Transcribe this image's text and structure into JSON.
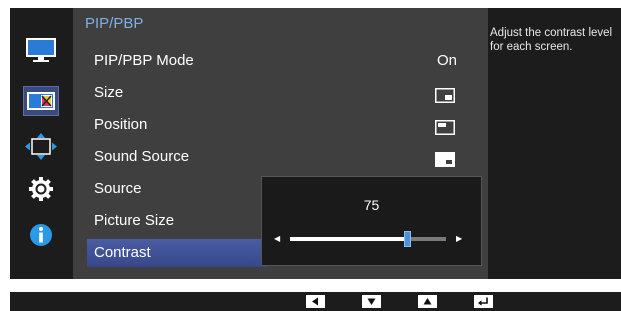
{
  "menu": {
    "title": "PIP/PBP",
    "items": [
      {
        "label": "PIP/PBP Mode",
        "value": "On"
      },
      {
        "label": "Size",
        "icon": "pip-size-icon"
      },
      {
        "label": "Position",
        "icon": "pip-position-icon"
      },
      {
        "label": "Sound Source",
        "icon": "sound-source-icon"
      },
      {
        "label": "Source"
      },
      {
        "label": "Picture Size"
      },
      {
        "label": "Contrast"
      }
    ]
  },
  "description": "Adjust the contrast level for each screen.",
  "slider": {
    "value": "75",
    "level_fraction": 0.75
  },
  "categories": [
    {
      "icon": "picture-icon"
    },
    {
      "icon": "color-icon",
      "selected": true
    },
    {
      "icon": "size-position-icon"
    },
    {
      "icon": "settings-icon"
    },
    {
      "icon": "info-icon"
    }
  ],
  "nav_buttons": [
    {
      "icon": "left-arrow-icon"
    },
    {
      "icon": "down-arrow-icon"
    },
    {
      "icon": "up-arrow-icon"
    },
    {
      "icon": "enter-icon"
    }
  ],
  "colors": {
    "selection": "#3f50a0",
    "title": "#7fb0e0",
    "thumb": "#4f8fd8"
  }
}
